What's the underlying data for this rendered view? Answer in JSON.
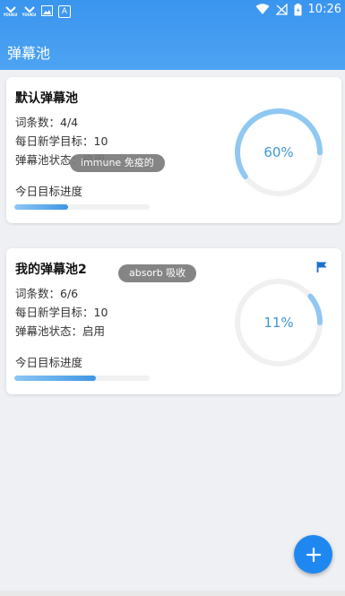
{
  "status_bar": {
    "time": "10:26",
    "left_icons": [
      {
        "name": "youku-icon",
        "text": "YOUKU"
      },
      {
        "name": "youku-icon",
        "text": "YOUKU"
      },
      {
        "name": "image-icon",
        "text": ""
      },
      {
        "name": "a-app-icon",
        "text": "A"
      }
    ]
  },
  "header": {
    "title": "弹幕池"
  },
  "cards": [
    {
      "name": "默认弹幕池",
      "word_count": "词条数：4/4",
      "daily_goal": "每日新学目标：10",
      "status": "弹幕池状态：启用",
      "progress_label": "今日目标进度",
      "progress_percent_text": "60%",
      "progress_fraction": 0.6,
      "bar_fraction": 0.4,
      "flagged": false,
      "toast": "immune 免疫的"
    },
    {
      "name": "我的弹幕池2",
      "word_count": "词条数：6/6",
      "daily_goal": "每日新学目标：10",
      "status": "弹幕池状态：启用",
      "progress_label": "今日目标进度",
      "progress_percent_text": "11%",
      "progress_fraction": 0.11,
      "bar_fraction": 0.6,
      "flagged": true,
      "toast": "absorb 吸收"
    }
  ],
  "fab": {
    "icon": "plus-icon"
  },
  "colors": {
    "header": "#3a95ef",
    "accent": "#1e88f0",
    "ring": "#8fc8f2",
    "ring_track": "#f0f0f0"
  }
}
